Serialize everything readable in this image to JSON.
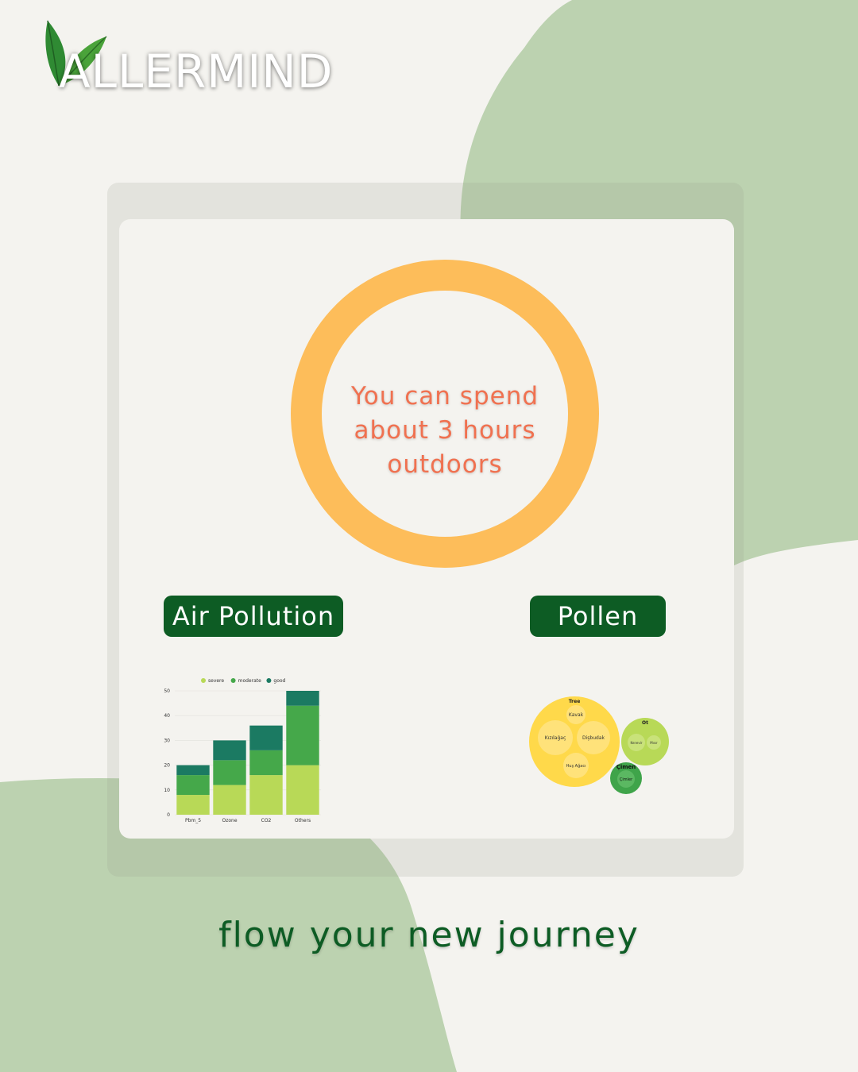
{
  "brand": {
    "name": "ALLERMIND",
    "colors": {
      "green_dark": "#0d5c24",
      "blob": "#bcd2b0",
      "ring": "#fdbd5a",
      "ring_text": "#f07150"
    }
  },
  "status": {
    "message_line1": "You can spend",
    "message_line2": "about 3 hours",
    "message_line3": "outdoors"
  },
  "buttons": {
    "air_pollution": "Air Pollution",
    "pollen": "Pollen"
  },
  "chart_data": {
    "type": "bar",
    "stacked": true,
    "categories": [
      "Pbm_5",
      "Ozone",
      "CO2",
      "Others"
    ],
    "series": [
      {
        "name": "severe",
        "color": "#b8d957",
        "values": [
          8,
          12,
          16,
          20
        ]
      },
      {
        "name": "moderate",
        "color": "#45a84a",
        "values": [
          8,
          10,
          10,
          24
        ]
      },
      {
        "name": "good",
        "color": "#1b7a62",
        "values": [
          4,
          8,
          10,
          6
        ]
      }
    ],
    "yticks": [
      0,
      10,
      20,
      30,
      40,
      50
    ],
    "ylim": [
      0,
      50
    ],
    "legend_position": "top",
    "grid": true
  },
  "pollen": {
    "groups": [
      {
        "label": "Tree",
        "items": [
          "Kavak",
          "Kızılağaç",
          "Dişbudak",
          "Huş Ağacı"
        ]
      },
      {
        "label": "Ot",
        "items": [
          "Kenevir",
          "Mısır"
        ]
      },
      {
        "label": "Çimen",
        "items": [
          "Çimler"
        ]
      }
    ]
  },
  "tagline": "flow your new journey"
}
